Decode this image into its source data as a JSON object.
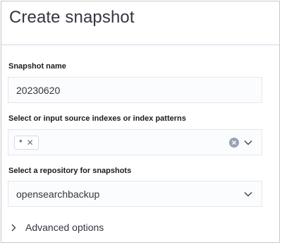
{
  "header": {
    "title": "Create snapshot"
  },
  "snapshot_name": {
    "label": "Snapshot name",
    "value": "20230620"
  },
  "indexes": {
    "label": "Select or input source indexes or index patterns",
    "chips": [
      "*"
    ],
    "clear_icon": "clear-circle-icon",
    "toggle_icon": "chevron-down-icon"
  },
  "repository": {
    "label": "Select a repository for snapshots",
    "selected": "opensearchbackup",
    "toggle_icon": "chevron-down-icon"
  },
  "advanced": {
    "label": "Advanced options",
    "icon": "chevron-right-icon"
  }
}
